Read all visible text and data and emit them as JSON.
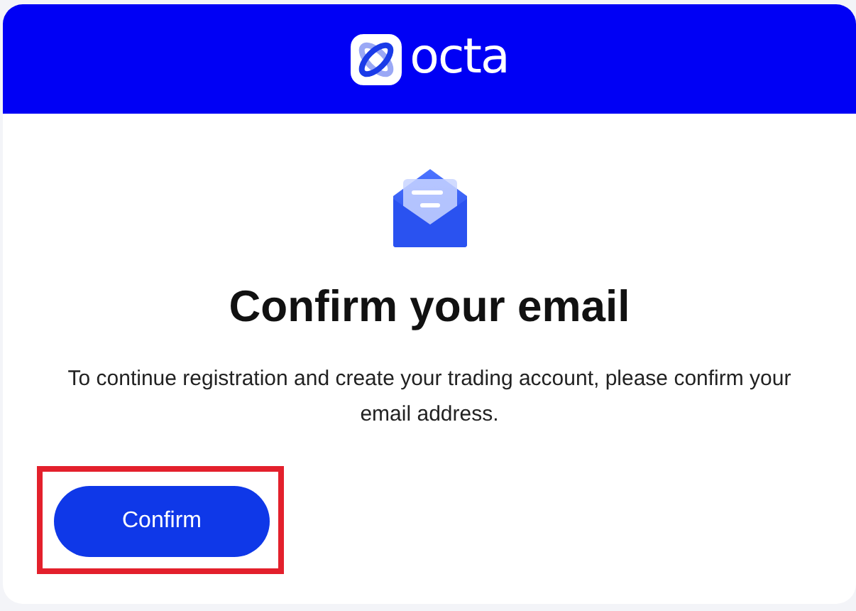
{
  "header": {
    "brand": "octa"
  },
  "title": "Confirm your email",
  "message": "To continue registration and create your trading account, please confirm your email address.",
  "button": {
    "label": "Confirm",
    "highlighted": true
  }
}
